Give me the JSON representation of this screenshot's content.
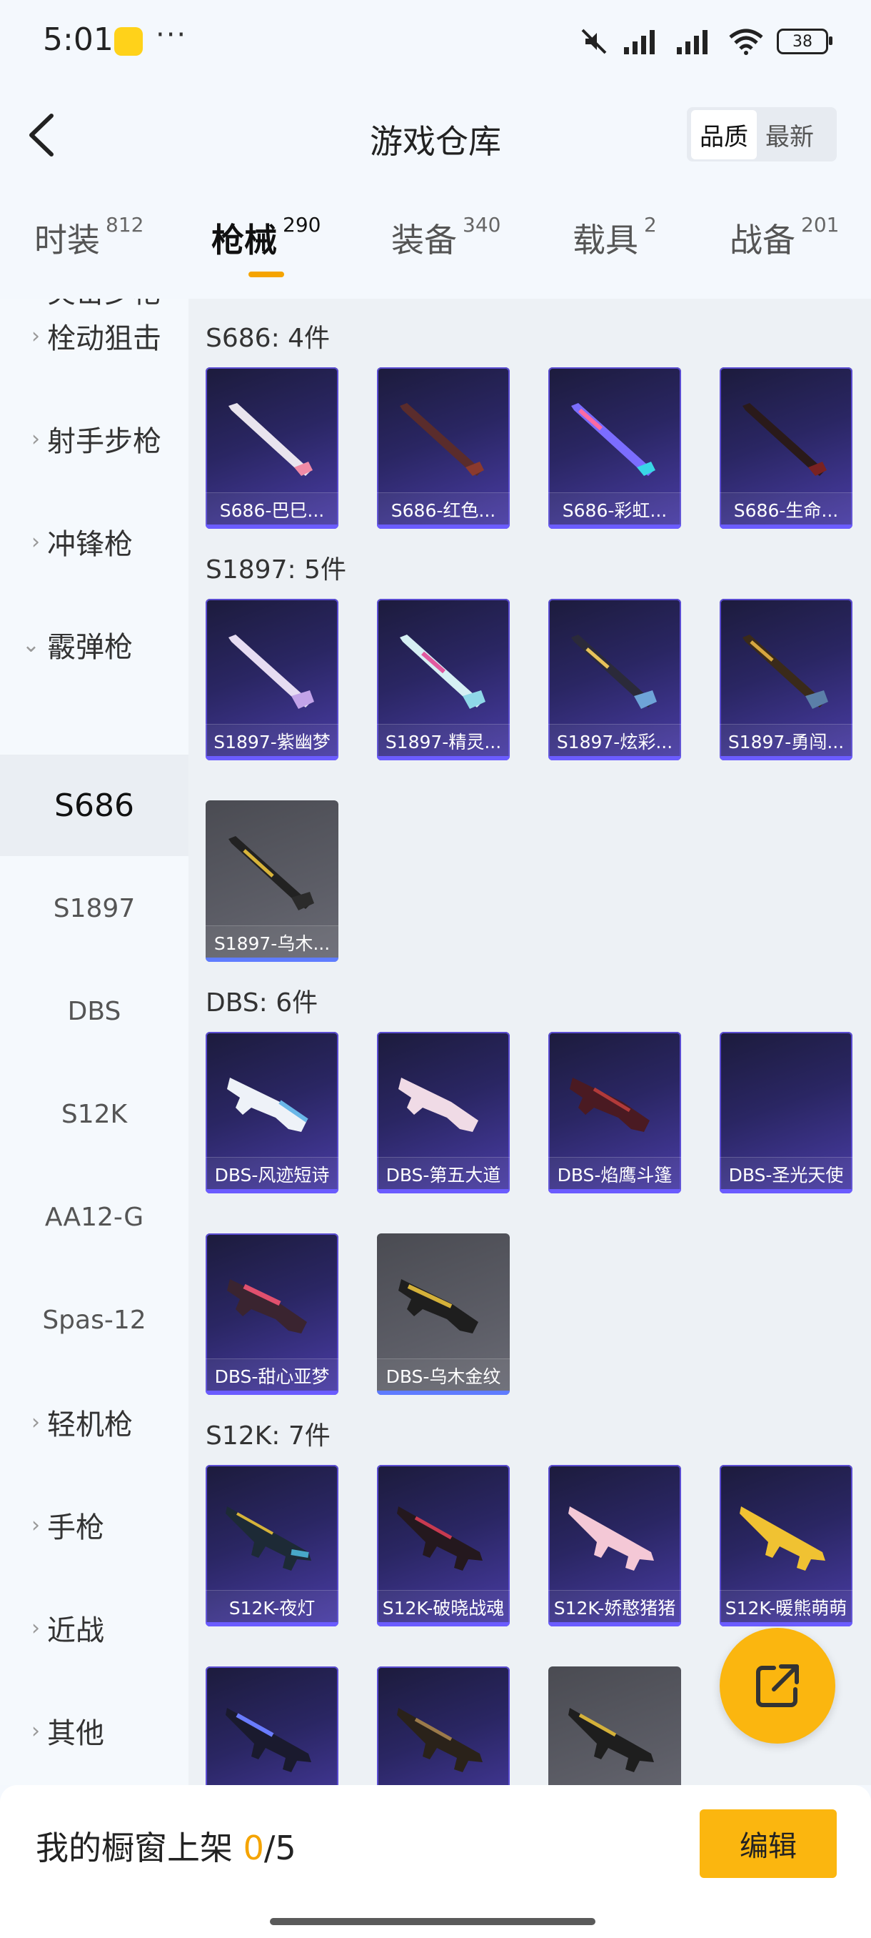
{
  "status": {
    "time": "5:01",
    "dots": "···",
    "battery": "38"
  },
  "header": {
    "title": "游戏仓库",
    "sort_options": [
      "品质",
      "最新"
    ],
    "active_sort": "品质"
  },
  "tabs": [
    {
      "label": "时装",
      "count": "812"
    },
    {
      "label": "枪械",
      "count": "290"
    },
    {
      "label": "装备",
      "count": "340"
    },
    {
      "label": "载具",
      "count": "2"
    },
    {
      "label": "战备",
      "count": "201"
    }
  ],
  "sidebar": {
    "partial_top": "突击步枪",
    "categories": [
      "栓动狙击",
      "射手步枪",
      "冲锋枪",
      "霰弹枪"
    ],
    "subitems": [
      "S686",
      "S1897",
      "DBS",
      "S12K",
      "AA12-G",
      "Spas-12"
    ],
    "bottom_categories": [
      "轻机枪",
      "手枪",
      "近战",
      "其他"
    ]
  },
  "sections": [
    {
      "title": "S686: 4件",
      "items": [
        "S686-巴巳...",
        "S686-红色...",
        "S686-彩虹...",
        "S686-生命..."
      ]
    },
    {
      "title": "S1897: 5件",
      "items": [
        "S1897-紫幽梦",
        "S1897-精灵...",
        "S1897-炫彩...",
        "S1897-勇闯...",
        "S1897-乌木..."
      ]
    },
    {
      "title": "DBS: 6件",
      "items": [
        "DBS-风迹短诗",
        "DBS-第五大道",
        "DBS-焰鹰斗篷",
        "DBS-圣光天使",
        "DBS-甜心亚梦",
        "DBS-乌木金纹"
      ]
    },
    {
      "title": "S12K: 7件",
      "items": [
        "S12K-夜灯",
        "S12K-破晓战魂",
        "S12K-娇憨猪猪",
        "S12K-暖熊萌萌",
        "",
        "",
        ""
      ]
    }
  ],
  "footer": {
    "label": "我的橱窗上架",
    "current": "0",
    "total": "/5",
    "edit": "编辑"
  },
  "colors": {
    "accent": "#fbb60f",
    "card_purple": "#2a2663",
    "card_grey": "#5c5d66"
  }
}
